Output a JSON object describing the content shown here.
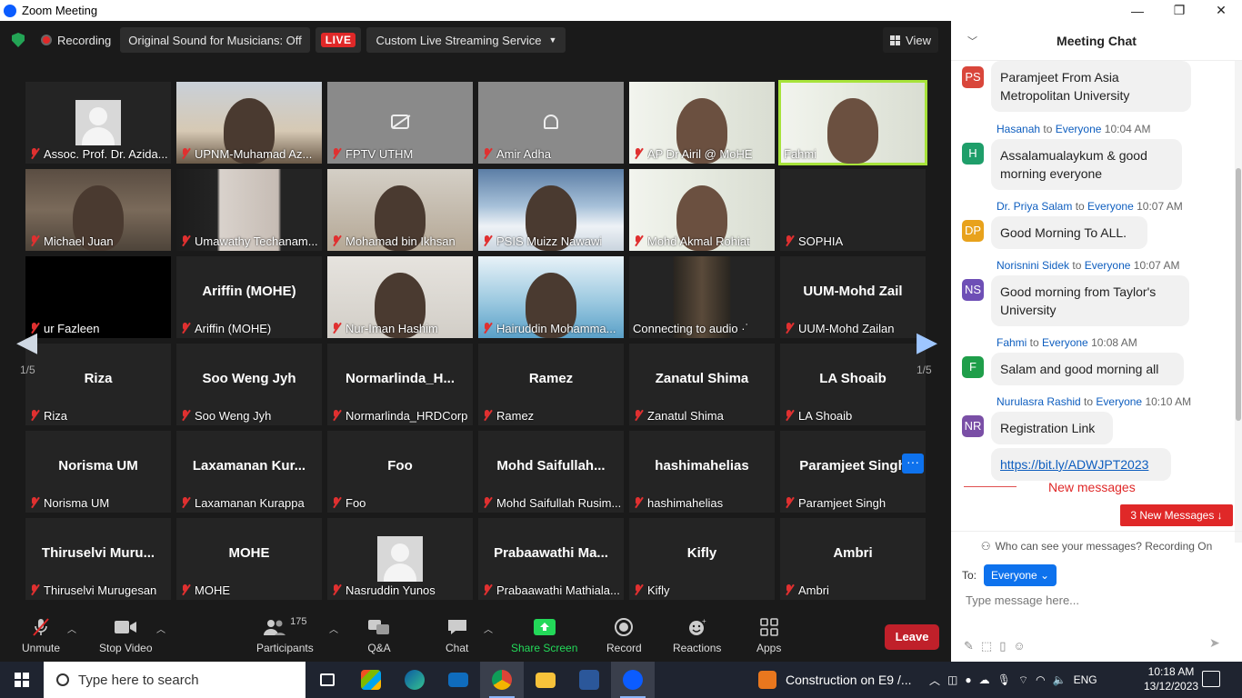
{
  "window": {
    "title": "Zoom Meeting",
    "minimize": "—",
    "maximize": "❐",
    "close": "✕"
  },
  "topbar": {
    "recording_label": "Recording",
    "original_sound": "Original Sound for Musicians: Off",
    "live_badge": "LIVE",
    "streaming_service": "Custom Live Streaming Service",
    "view_label": "View"
  },
  "pagination": {
    "left_page": "1/5",
    "right_page": "1/5"
  },
  "tiles": [
    {
      "name": "Assoc. Prof. Dr. Azida...",
      "display": "",
      "video": "avatar"
    },
    {
      "name": "UPNM-Muhamad Az...",
      "display": "",
      "video": "office"
    },
    {
      "name": "FPTV UTHM",
      "display": "",
      "video": "camoff"
    },
    {
      "name": "Amir Adha",
      "display": "",
      "video": "bell"
    },
    {
      "name": "AP Dr Airil @ MoHE",
      "display": "",
      "video": "webinar"
    },
    {
      "name": "Fahmi",
      "display": "",
      "video": "webinar",
      "active": true
    },
    {
      "name": "Michael Juan",
      "display": "",
      "video": "room"
    },
    {
      "name": "Umawathy Techanam...",
      "display": "",
      "video": "wall"
    },
    {
      "name": "Mohamad bin Ikhsan",
      "display": "",
      "video": "beige"
    },
    {
      "name": "PSIS Muizz Nawawi",
      "display": "",
      "video": "snow"
    },
    {
      "name": "Mohd Akmal Rohiat",
      "display": "",
      "video": "webinar"
    },
    {
      "name": "SOPHIA",
      "display": "",
      "video": "none"
    },
    {
      "name": "ur Fazleen",
      "display": "",
      "video": "black"
    },
    {
      "name": "Ariffin (MOHE)",
      "display": "Ariffin (MOHE)",
      "video": "none"
    },
    {
      "name": "Nur-Iman Hashim",
      "display": "",
      "video": "suit"
    },
    {
      "name": "Hairuddin Mohamma...",
      "display": "",
      "video": "uthm"
    },
    {
      "name": "Connecting to audio ·˙",
      "display": "",
      "video": "dark",
      "nomic": true
    },
    {
      "name": "UUM-Mohd Zailan",
      "display": "UUM-Mohd  Zail",
      "video": "none"
    },
    {
      "name": "Riza",
      "display": "Riza",
      "video": "none"
    },
    {
      "name": "Soo Weng Jyh",
      "display": "Soo Weng Jyh",
      "video": "none",
      "nomic": true
    },
    {
      "name": "Normarlinda_HRDCorp",
      "display": "Normarlinda_H...",
      "video": "none"
    },
    {
      "name": "Ramez",
      "display": "Ramez",
      "video": "none"
    },
    {
      "name": "Zanatul Shima",
      "display": "Zanatul Shima",
      "video": "none"
    },
    {
      "name": "LA Shoaib",
      "display": "LA Shoaib",
      "video": "none"
    },
    {
      "name": "Norisma UM",
      "display": "Norisma UM",
      "video": "none"
    },
    {
      "name": "Laxamanan Kurappa",
      "display": "Laxamanan  Kur...",
      "video": "none"
    },
    {
      "name": "Foo",
      "display": "Foo",
      "video": "none"
    },
    {
      "name": "Mohd Saifullah Rusim...",
      "display": "Mohd  Saifullah...",
      "video": "none"
    },
    {
      "name": "hashimahelias",
      "display": "hashimahelias",
      "video": "none"
    },
    {
      "name": "Paramjeet Singh",
      "display": "Paramjeet Singh",
      "video": "none"
    },
    {
      "name": "Thiruselvi Murugesan",
      "display": "Thiruselvi  Muru...",
      "video": "none"
    },
    {
      "name": "MOHE",
      "display": "MOHE",
      "video": "none"
    },
    {
      "name": "Nasruddin Yunos",
      "display": "",
      "video": "avatar",
      "nomic": true
    },
    {
      "name": "Prabaawathi Mathiala...",
      "display": "Prabaawathi  Ma...",
      "video": "none"
    },
    {
      "name": "Kifly",
      "display": "Kifly",
      "video": "none"
    },
    {
      "name": "Ambri",
      "display": "Ambri",
      "video": "none",
      "nomic": true
    }
  ],
  "more_button": "···",
  "toolbar": {
    "unmute": "Unmute",
    "stop_video": "Stop Video",
    "participants": "Participants",
    "participants_count": "175",
    "qa": "Q&A",
    "chat": "Chat",
    "share_screen": "Share Screen",
    "record": "Record",
    "reactions": "Reactions",
    "apps": "Apps",
    "leave": "Leave",
    "accent_green": "#23d959"
  },
  "chat": {
    "title": "Meeting Chat",
    "messages": [
      {
        "initials": "PS",
        "color": "#d9463b",
        "from": "",
        "to": "",
        "time": "",
        "text": "Paramjeet From Asia Metropolitan University"
      },
      {
        "initials": "H",
        "color": "#1f9e6a",
        "from": "Hasanah",
        "to": "Everyone",
        "time": "10:04 AM",
        "text": "Assalamualaykum & good morning everyone"
      },
      {
        "initials": "DP",
        "color": "#e8a21c",
        "from": "Dr. Priya Salam",
        "to": "Everyone",
        "time": "10:07 AM",
        "text": "Good Morning To ALL."
      },
      {
        "initials": "NS",
        "color": "#6e4fb6",
        "from": "Norisnini Sidek",
        "to": "Everyone",
        "time": "10:07 AM",
        "text": "Good morning from Taylor's University"
      },
      {
        "initials": "F",
        "color": "#1f9e4a",
        "from": "Fahmi",
        "to": "Everyone",
        "time": "10:08 AM",
        "text": "Salam and good morning all"
      },
      {
        "initials": "NR",
        "color": "#7a4fa6",
        "from": "Nurulasra Rashid",
        "to": "Everyone",
        "time": "10:10 AM",
        "text": "Registration Link"
      }
    ],
    "link": "https://bit.ly/ADWJPT2023",
    "new_messages": "New messages",
    "new_badge": "3 New Messages ↓",
    "who_can_see": "Who can see your messages? Recording On",
    "to_label": "To:",
    "to_value": "Everyone",
    "placeholder": "Type message here..."
  },
  "taskbar": {
    "search_placeholder": "Type here to search",
    "notification": "Construction on E9 /...",
    "lang": "ENG",
    "time": "10:18 AM",
    "date": "13/12/2023"
  }
}
